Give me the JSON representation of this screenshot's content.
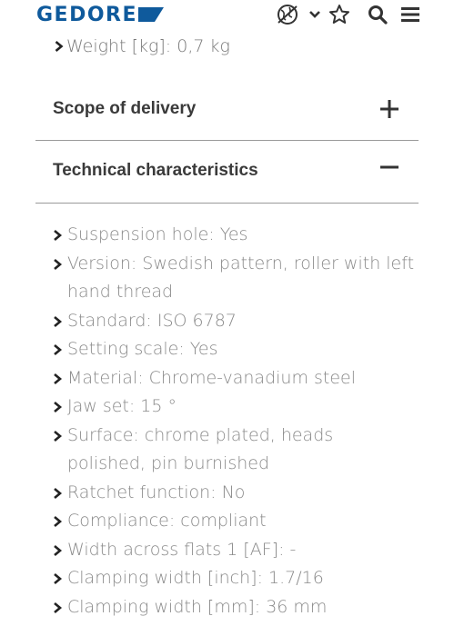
{
  "header": {
    "logo_text": "GEDORE",
    "brand_color": "#0f5a9c",
    "icons": [
      "globe-icon",
      "chevron-down-icon",
      "star-icon",
      "search-icon",
      "menu-icon"
    ]
  },
  "top_item": "Weight [kg]: 0,7 kg",
  "sections": [
    {
      "title": "Scope of delivery",
      "toggle": "plus-icon"
    },
    {
      "title": "Technical characteristics",
      "toggle": "minus-icon"
    }
  ],
  "characteristics": [
    "Suspension hole: Yes",
    "Version: Swedish pattern, roller with left hand thread",
    "Standard: ISO 6787",
    "Setting scale: Yes",
    "Material: Chrome-vanadium steel",
    "Jaw set: 15 °",
    "Surface: chrome plated, heads polished, pin burnished",
    "Ratchet function: No",
    "Compliance: compliant",
    "Width across flats 1 [AF]: -",
    "Clamping width [inch]: 1.7/16",
    "Clamping width [mm]: 36 mm"
  ]
}
